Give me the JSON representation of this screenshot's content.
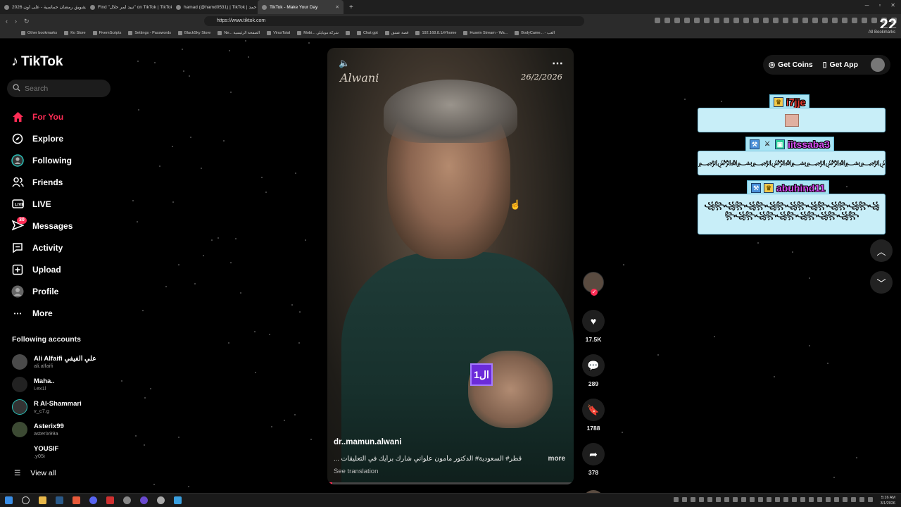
{
  "browser": {
    "tabs": [
      {
        "title": "تشويق رمضان حماسية - على اون 2026"
      },
      {
        "title": "Find \"تبيد لمر حلال\" on TikTok | TikTok"
      },
      {
        "title": "hamad (@hamd0531) | TikTok | حمد"
      },
      {
        "title": "TikTok - Make Your Day"
      }
    ],
    "url": "https://www.tiktok.com",
    "bookmarks": [
      "Other bookmarks",
      "Ko Store",
      "FivemScripts",
      "Settings - Passwords",
      "BlackSky Store",
      "Ne... الصفحة الرئيسية",
      "VirusTotal",
      "Mobi... شركة موبايلي",
      "",
      "Chat gpt",
      "قصة عشق",
      "192.168.8.1/#/home",
      "Husein Stream - Wa...",
      "BodyCame... - العب"
    ],
    "all_bookmarks": "All Bookmarks",
    "corner_number": "22"
  },
  "sidebar": {
    "logo": "TikTok",
    "search_placeholder": "Search",
    "nav": [
      {
        "label": "For You",
        "icon": "home-icon"
      },
      {
        "label": "Explore",
        "icon": "compass-icon"
      },
      {
        "label": "Following",
        "icon": "following-icon"
      },
      {
        "label": "Friends",
        "icon": "friends-icon"
      },
      {
        "label": "LIVE",
        "icon": "live-icon"
      },
      {
        "label": "Messages",
        "icon": "messages-icon",
        "badge": "30"
      },
      {
        "label": "Activity",
        "icon": "activity-icon"
      },
      {
        "label": "Upload",
        "icon": "upload-icon"
      },
      {
        "label": "Profile",
        "icon": "profile-icon"
      },
      {
        "label": "More",
        "icon": "more-icon"
      }
    ],
    "following_title": "Following accounts",
    "following": [
      {
        "name": "Ali Alfaifi علي الفيفي",
        "handle": "ali.alfaifi"
      },
      {
        "name": "Maha..",
        "handle": "i.ex1l"
      },
      {
        "name": "R Al-Shammari",
        "handle": "v_c7.g"
      },
      {
        "name": "Asterix99",
        "handle": "asterix99a"
      },
      {
        "name": "YOUSIF",
        "handle": ".y05i"
      }
    ],
    "view_all": "View all"
  },
  "video": {
    "brand": "Alwani",
    "date": "26/2/2026",
    "sticker": "ال1",
    "username": "dr..mamun.alwani",
    "caption": "قطر# السعودية# الدكتور مأمون علواني شارك برأيك في التعليقات ...",
    "more": "more",
    "see_translation": "See translation",
    "progress": 0.02
  },
  "actions": {
    "likes": "17.5K",
    "comments": "289",
    "saves": "1788",
    "shares": "378"
  },
  "header": {
    "get_coins": "Get Coins",
    "get_app": "Get App"
  },
  "chat": [
    {
      "name": "i7jje",
      "message": ""
    },
    {
      "name": "iitssaba3",
      "message": "﷽﷽﷽﷽﷽﷽﷽﷽﷽﷽﷽﷽"
    },
    {
      "name": "abuhind11",
      "message": "꧁꧂꧁꧂꧁꧂꧁꧂꧁꧂꧁꧂꧁꧂꧁꧂꧁꧂꧁꧂꧁꧂꧁꧂꧁꧂꧁꧂꧁꧂"
    }
  ],
  "taskbar": {
    "time": "5:16 AM",
    "date": "3/1/2026"
  },
  "colors": {
    "accent": "#fe2c55",
    "chat_bg": "#c8eef8"
  }
}
